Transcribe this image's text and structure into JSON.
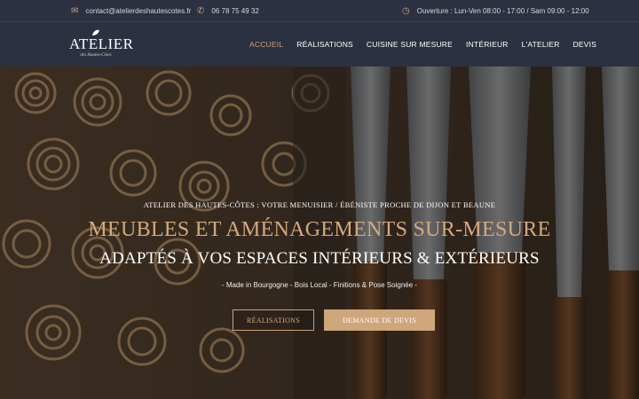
{
  "topbar": {
    "email": "contact@atelierdeshautescotes.fr",
    "phone": "06 78 75 49 32",
    "hours": "Ouverture : Lun-Ven 08:00 - 17:00 / Sam 09:00 - 12:00",
    "icons": {
      "email": "envelope-icon",
      "phone": "phone-icon",
      "hours": "clock-icon"
    },
    "icon_color": "#c9a27a"
  },
  "logo": {
    "title": "ATELIER",
    "subtitle": "des Hautes-Côtes"
  },
  "nav": {
    "items": [
      "ACCUEIL",
      "RÉALISATIONS",
      "CUISINE SUR MESURE",
      "INTÉRIEUR",
      "L'ATELIER",
      "DEVIS"
    ],
    "active_index": 0,
    "active_color": "#c9a27a"
  },
  "hero": {
    "kicker": "ATELIER DES HAUTES-CÔTES : VOTRE MENUISIER / ÉBÉNISTE PROCHE DE DIJON ET BEAUNE",
    "headline": "MEUBLES ET AMÉNAGEMENTS SUR-MESURE",
    "subheadline": "ADAPTÉS À VOS ESPACES INTÉRIEURS & EXTÉRIEURS",
    "tagline": "- Made in Bourgogne - Bois Local - Finitions & Pose Soignée -",
    "buttons": {
      "primary": "DEMANDE DE DEVIS",
      "secondary": "RÉALISATIONS"
    },
    "accent_color": "#cda67a"
  }
}
